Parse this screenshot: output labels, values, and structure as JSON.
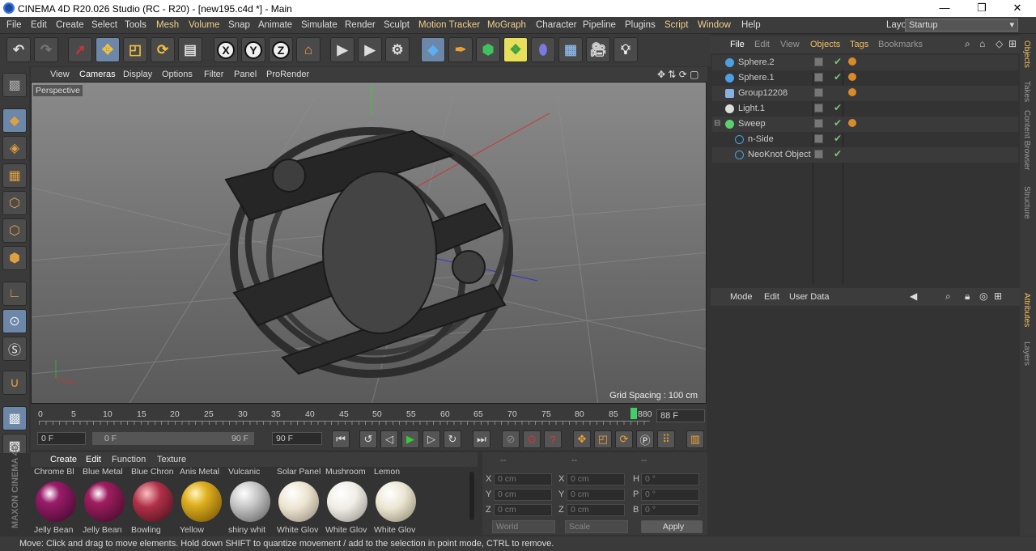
{
  "window": {
    "title": "CINEMA 4D R20.026 Studio (RC - R20) - [new195.c4d *] - Main",
    "min": "—",
    "max": "❐",
    "close": "✕"
  },
  "menubar": {
    "items": [
      "File",
      "Edit",
      "Create",
      "Select",
      "Tools",
      "Mesh",
      "Volume",
      "Snap",
      "Animate",
      "Simulate",
      "Render",
      "Sculpt",
      "Motion Tracker",
      "MoGraph",
      "Character",
      "Pipeline",
      "Plugins",
      "Script",
      "Window",
      "Help"
    ],
    "layout_label": "Layout:",
    "layout_value": "Startup"
  },
  "viewport": {
    "menu": [
      "View",
      "Cameras",
      "Display",
      "Options",
      "Filter",
      "Panel",
      "ProRender"
    ],
    "camera": "Perspective",
    "grid_spacing": "Grid Spacing : 100 cm"
  },
  "timeline": {
    "ticks": [
      "0",
      "5",
      "10",
      "15",
      "20",
      "25",
      "30",
      "35",
      "40",
      "45",
      "50",
      "55",
      "60",
      "65",
      "70",
      "75",
      "80",
      "85",
      "880"
    ],
    "current_frame": "88 F"
  },
  "transport": {
    "start": "0 F",
    "range_start": "0 F",
    "range_end": "90 F",
    "end": "90 F"
  },
  "materials": {
    "menu": [
      "Create",
      "Edit",
      "Function",
      "Texture"
    ],
    "items": [
      {
        "top": "Chrome Bl",
        "bottom": "Jelly Bean",
        "color": "#9a1c6a"
      },
      {
        "top": "Blue Metal",
        "bottom": "Jelly Bean",
        "color": "#a01e60"
      },
      {
        "top": "Blue Chron",
        "bottom": "Bowling",
        "color": "#b03048"
      },
      {
        "top": "Anis Metal",
        "bottom": "Yellow",
        "color": "#e0b020"
      },
      {
        "top": "Vulcanic",
        "bottom": "shiny whit",
        "color": "#c8c8c8"
      },
      {
        "top": "Solar Panel",
        "bottom": "White Glov",
        "color": "#ece4d0"
      },
      {
        "top": "Mushroom",
        "bottom": "White Glov",
        "color": "#f0ede6"
      },
      {
        "top": "Lemon",
        "bottom": "White Glov",
        "color": "#ebe6d2"
      }
    ]
  },
  "coords": {
    "header": [
      "--",
      "--",
      "--"
    ],
    "rows": [
      {
        "a": "X",
        "av": "0 cm",
        "b": "X",
        "bv": "0 cm",
        "c": "H",
        "cv": "0 °"
      },
      {
        "a": "Y",
        "av": "0 cm",
        "b": "Y",
        "bv": "0 cm",
        "c": "P",
        "cv": "0 °"
      },
      {
        "a": "Z",
        "av": "0 cm",
        "b": "Z",
        "bv": "0 cm",
        "c": "B",
        "cv": "0 °"
      }
    ],
    "mode1": "World",
    "mode2": "Scale",
    "apply": "Apply"
  },
  "objects": {
    "menu": [
      "File",
      "Edit",
      "View",
      "Objects",
      "Tags",
      "Bookmarks"
    ],
    "items": [
      {
        "name": "Sphere.2",
        "color": "#4aa0e0"
      },
      {
        "name": "Sphere.1",
        "color": "#4aa0e0"
      },
      {
        "name": "Group12208",
        "color": "#8ab0e0"
      },
      {
        "name": "Light.1",
        "color": "#dddddd"
      },
      {
        "name": "Sweep",
        "color": "#5cd070"
      },
      {
        "name": "n-Side",
        "color": "#4aa0e0"
      },
      {
        "name": "NeoKnot Object",
        "color": "#4aa0e0"
      }
    ]
  },
  "attributes": {
    "menu": [
      "Mode",
      "Edit",
      "User Data"
    ]
  },
  "sidetabs": [
    "Objects",
    "Takes",
    "Content Browser",
    "Structure",
    "Attributes",
    "Layers"
  ],
  "status": "Move: Click and drag to move elements. Hold down SHIFT to quantize movement / add to the selection in point mode, CTRL to remove.",
  "brand": "MAXON CINEMA 4D"
}
